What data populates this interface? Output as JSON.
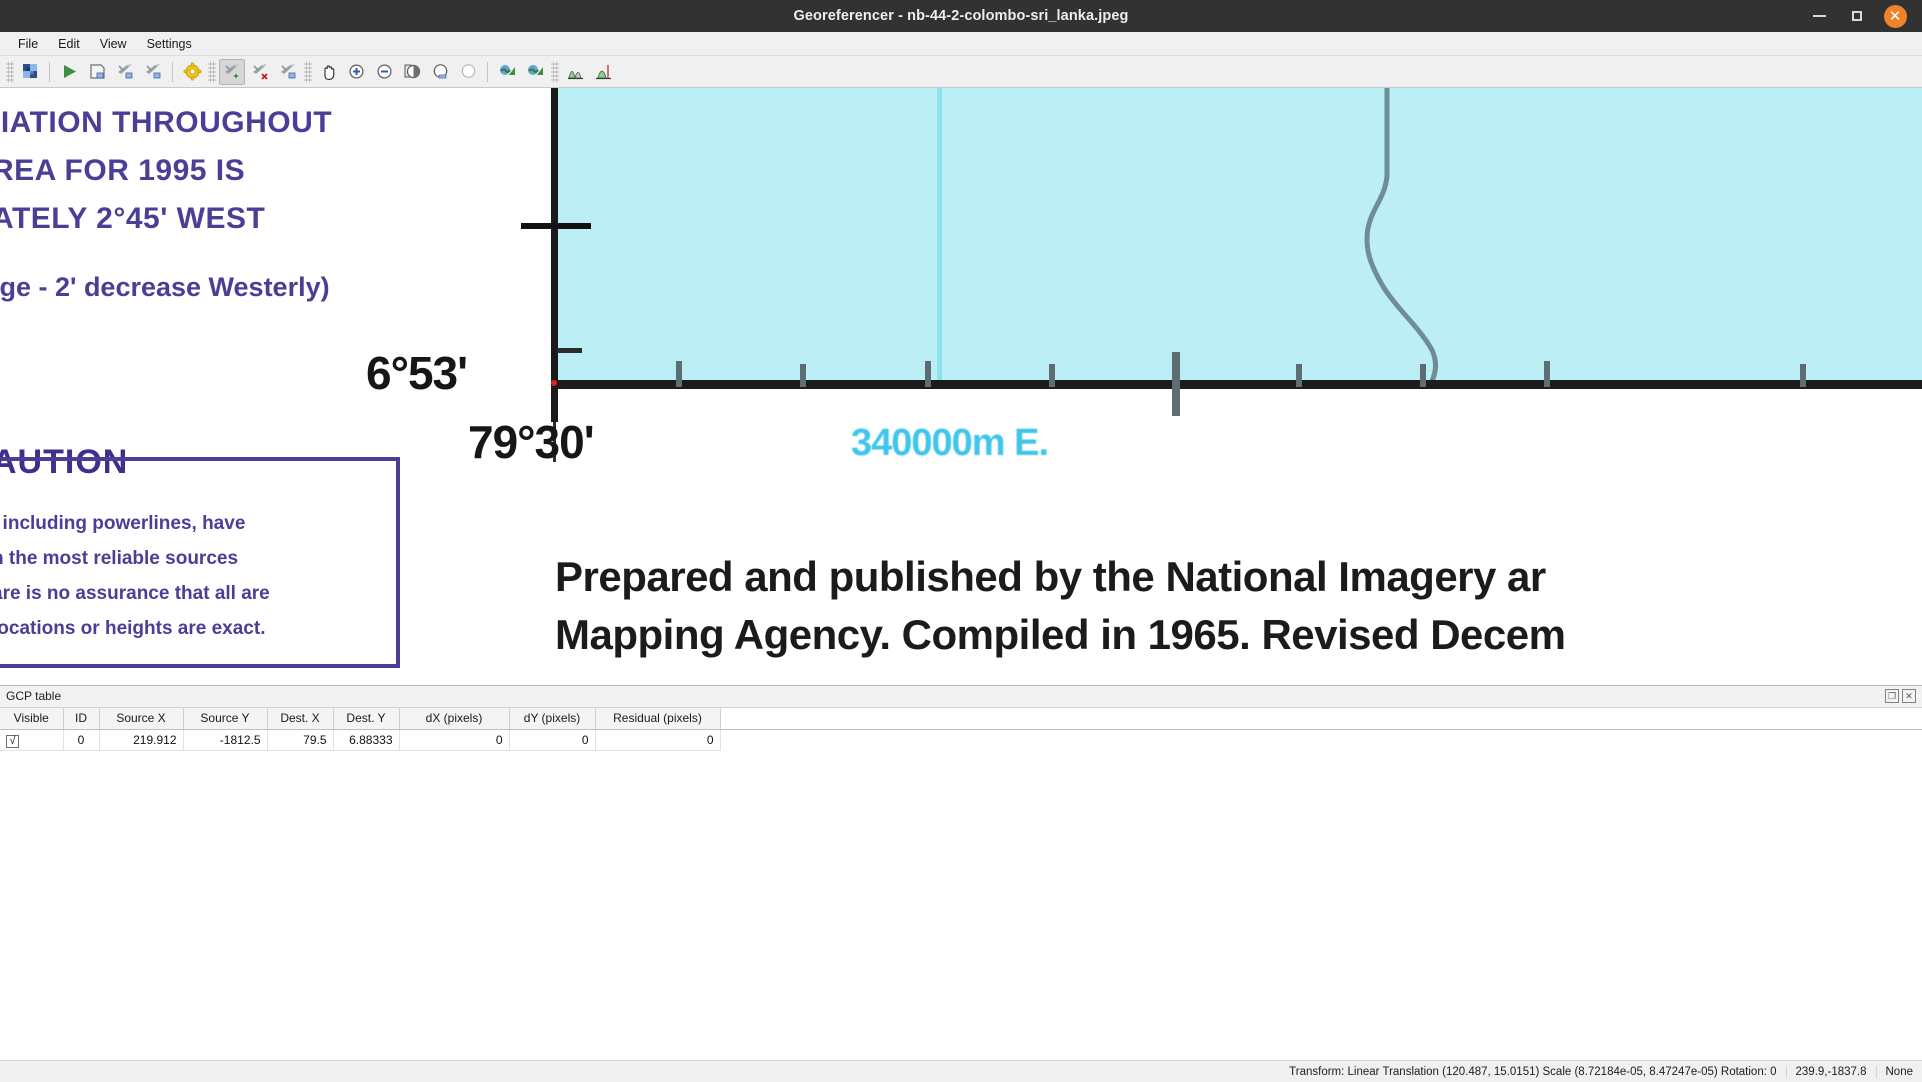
{
  "window": {
    "title": "Georeferencer - nb-44-2-colombo-sri_lanka.jpeg",
    "minimize_label": "–",
    "maximize_label": "",
    "close_label": "✕"
  },
  "menubar": {
    "items": [
      {
        "label": "File"
      },
      {
        "label": "Edit"
      },
      {
        "label": "View"
      },
      {
        "label": "Settings"
      }
    ]
  },
  "toolbar": {
    "groups": [
      {
        "buttons": [
          {
            "icon": "open-raster-icon",
            "tooltip": "Open raster"
          }
        ]
      },
      {
        "buttons": [
          {
            "icon": "start-georeferencing-icon",
            "tooltip": "Start georeferencing"
          },
          {
            "icon": "generate-gdal-script-icon",
            "tooltip": "Generate GDAL script"
          },
          {
            "icon": "load-gcp-points-icon",
            "tooltip": "Load GCP points"
          },
          {
            "icon": "save-gcp-points-icon",
            "tooltip": "Save GCP points as"
          },
          {
            "icon": "transformation-settings-icon",
            "tooltip": "Transformation settings"
          }
        ]
      },
      {
        "buttons": [
          {
            "icon": "add-point-icon",
            "tooltip": "Add point",
            "active": true
          },
          {
            "icon": "delete-point-icon",
            "tooltip": "Delete point"
          },
          {
            "icon": "move-gcp-point-icon",
            "tooltip": "Move GCP point"
          }
        ]
      },
      {
        "buttons": [
          {
            "icon": "pan-icon",
            "tooltip": "Pan"
          },
          {
            "icon": "zoom-in-icon",
            "tooltip": "Zoom in"
          },
          {
            "icon": "zoom-out-icon",
            "tooltip": "Zoom out"
          },
          {
            "icon": "zoom-to-layer-icon",
            "tooltip": "Zoom to layer"
          },
          {
            "icon": "zoom-last-icon",
            "tooltip": "Zoom last"
          },
          {
            "icon": "zoom-next-icon",
            "tooltip": "Zoom next"
          }
        ]
      },
      {
        "buttons": [
          {
            "icon": "link-georeferencer-to-qgis-icon",
            "tooltip": "Link Georeferencer to QGIS"
          },
          {
            "icon": "link-qgis-to-georeferencer-icon",
            "tooltip": "Link QGIS to Georeferencer"
          }
        ]
      },
      {
        "buttons": [
          {
            "icon": "full-histogram-stretch-icon",
            "tooltip": "Full histogram stretch"
          },
          {
            "icon": "local-histogram-stretch-icon",
            "tooltip": "Local histogram stretch"
          }
        ]
      }
    ]
  },
  "map": {
    "variation_note_lines": [
      "IIATION THROUGHOUT",
      "REA FOR 1995 IS",
      "ATELY 2°45' WEST"
    ],
    "annual_change": "ige - 2' decrease Westerly)",
    "caution_title": "AUTION",
    "caution_lines": [
      ", including  powerlines,  have",
      "n  the  most  reliable  sources",
      "are is no assurance that all are",
      "locations or heights are exact."
    ],
    "latitude_label": "6°53'",
    "longitude_label": "79°30'",
    "utm_easting_label": "340000m E.",
    "publisher_lines": [
      "Prepared and published by the National Imagery ar",
      "Mapping Agency. Compiled in 1965. Revised Decem"
    ],
    "colors": {
      "sea": "#bceef5",
      "sea_line": "#8fe0ef",
      "graticule": "#1a1a1a",
      "caution_purple": "#4a3f96",
      "utm_cyan": "#3fc6ea",
      "gcp_marker": "#e02020"
    }
  },
  "gcp_panel": {
    "title": "GCP table",
    "float_label": "❐",
    "close_label": "✕",
    "columns": [
      "Visible",
      "ID",
      "Source X",
      "Source Y",
      "Dest. X",
      "Dest. Y",
      "dX (pixels)",
      "dY (pixels)",
      "Residual (pixels)"
    ],
    "rows": [
      {
        "visible": "√",
        "id": "0",
        "source_x": "219.912",
        "source_y": "-1812.5",
        "dest_x": "79.5",
        "dest_y": "6.88333",
        "dx": "0",
        "dy": "0",
        "residual": "0"
      }
    ]
  },
  "statusbar": {
    "transform": "Transform: Linear Translation (120.487, 15.0151) Scale (8.72184e-05, 8.47247e-05) Rotation: 0",
    "coordinates": "239.9,-1837.8",
    "crs": "None"
  }
}
